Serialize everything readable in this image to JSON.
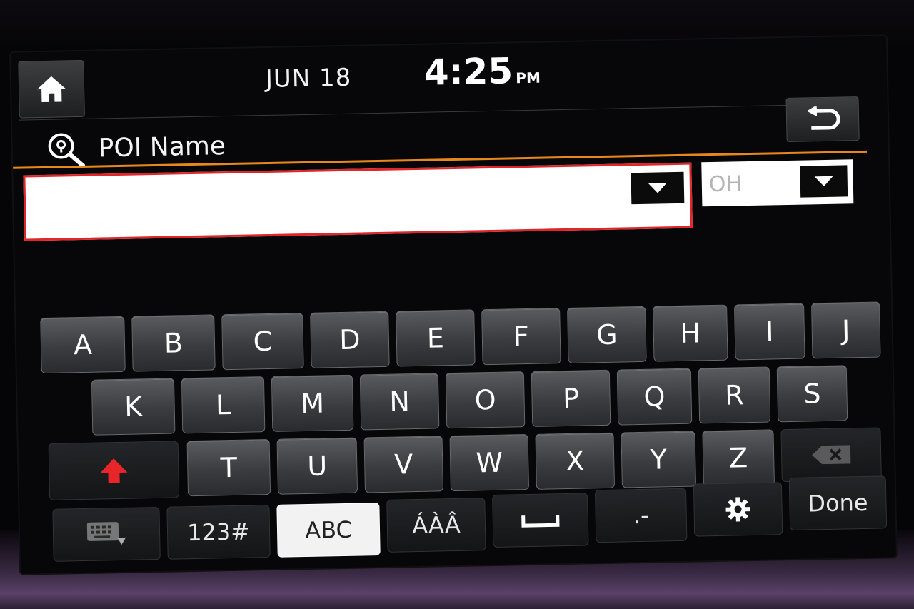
{
  "header": {
    "date": "JUN 18",
    "time": "4:25",
    "ampm": "PM"
  },
  "search": {
    "title": "POI Name",
    "query": "",
    "state": "OH"
  },
  "keyboard": {
    "row1": [
      "A",
      "B",
      "C",
      "D",
      "E",
      "F",
      "G",
      "H",
      "I",
      "J"
    ],
    "row2": [
      "K",
      "L",
      "M",
      "N",
      "O",
      "P",
      "Q",
      "R",
      "S"
    ],
    "row3": [
      "T",
      "U",
      "V",
      "W",
      "X",
      "Y",
      "Z"
    ],
    "numbers_label": "123#",
    "abc_label": "ABC",
    "accents_label": "ÁÀÂ",
    "punct_label": ".-",
    "done_label": "Done"
  },
  "colors": {
    "accent": "#e7871c",
    "input_border": "#e0262b",
    "shift": "#e8262a"
  },
  "icons": {
    "home": "home-icon",
    "back": "back-arrow-icon",
    "poi": "poi-search-icon",
    "shift": "shift-arrow-icon",
    "backspace": "backspace-icon",
    "space": "space-icon",
    "settings": "gear-icon",
    "keyboard_hide": "keyboard-hide-icon"
  }
}
